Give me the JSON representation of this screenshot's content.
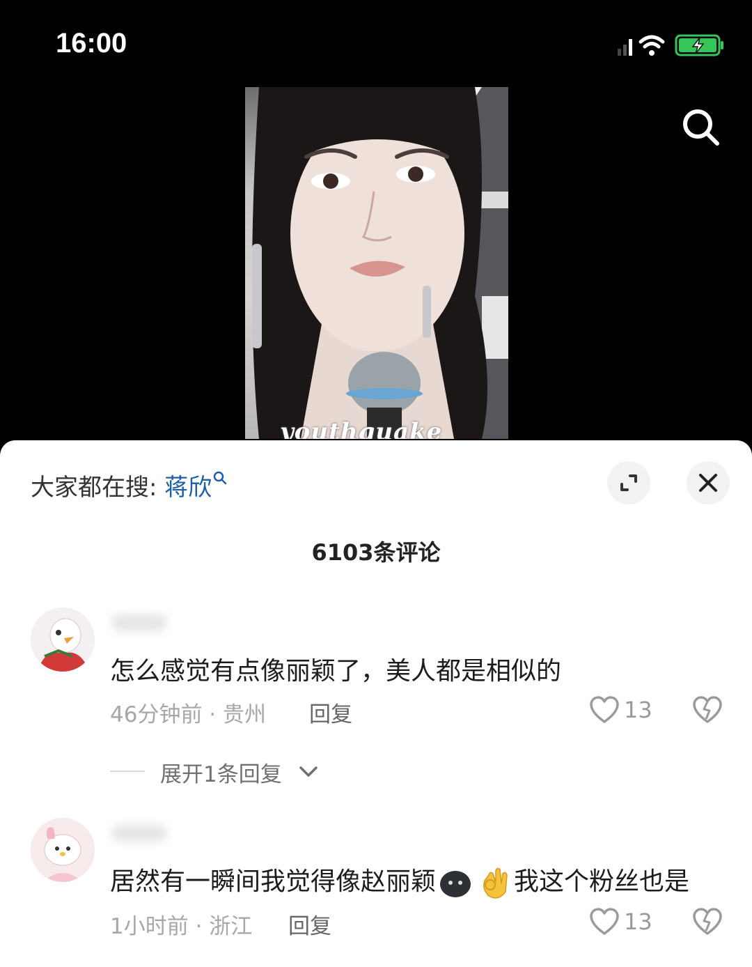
{
  "status_bar": {
    "time": "16:00"
  },
  "video": {
    "watermark": "youthquake"
  },
  "sheet": {
    "trending_prefix": "大家都在搜: ",
    "trending_keyword": "蒋欣",
    "comment_count": "6103条评论",
    "expand_replies_label": "展开1条回复"
  },
  "comments": [
    {
      "text": "怎么感觉有点像丽颖了，美人都是相似的",
      "time_location": "46分钟前 · 贵州",
      "reply_label": "回复",
      "likes": "13"
    },
    {
      "text_before": "居然有一瞬间我觉得像赵丽颖",
      "text_after": "我这个粉丝也是",
      "time_location": "1小时前 · 浙江",
      "reply_label": "回复",
      "likes": "13",
      "emojis": [
        "dark-blob-emoji",
        "ok-hand-emoji"
      ]
    }
  ],
  "icons": [
    "signal-icon",
    "wifi-icon",
    "battery-charging-icon",
    "search-icon",
    "expand-icon",
    "close-icon",
    "heart-icon",
    "broken-heart-icon",
    "chevron-down-icon"
  ],
  "colors": {
    "keyword_blue": "#1f5fa6",
    "battery_green": "#35c759",
    "meta_gray": "#a7a7a7"
  }
}
